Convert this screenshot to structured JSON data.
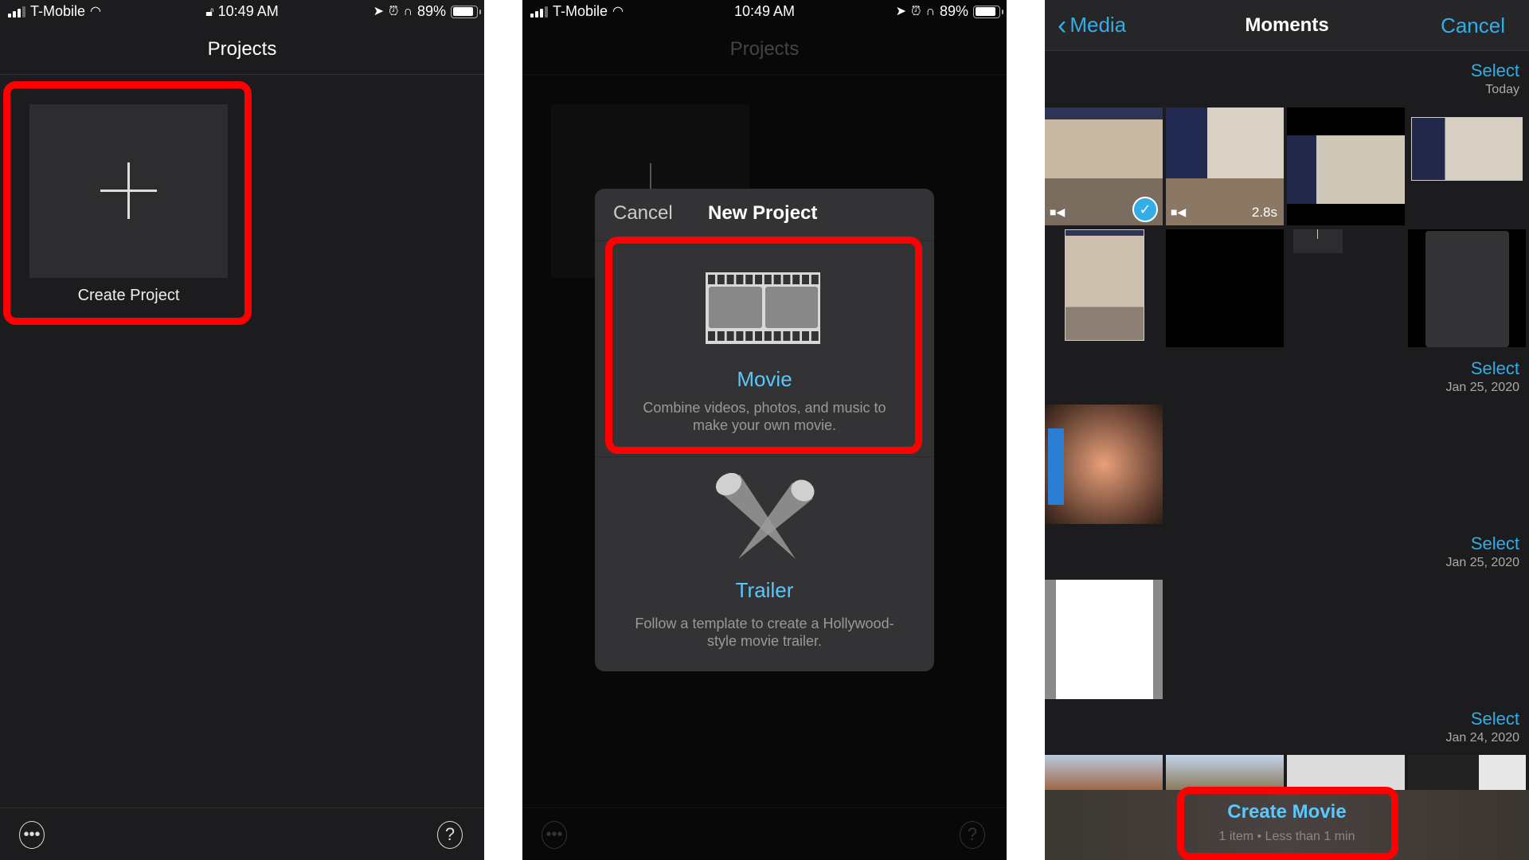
{
  "status_bar": {
    "carrier": "T-Mobile",
    "time": "10:49 AM",
    "battery": "89%",
    "battery_level": 0.89,
    "icons": [
      "signal-icon",
      "wifi-icon",
      "lock-icon",
      "location-icon",
      "alarm-icon",
      "headphones-icon",
      "battery-icon"
    ]
  },
  "panel1": {
    "title": "Projects",
    "create_project_label": "Create Project",
    "more_icon": "•••",
    "help_icon": "?"
  },
  "panel2": {
    "title": "Projects",
    "dialog": {
      "cancel_label": "Cancel",
      "title": "New Project",
      "options": [
        {
          "title": "Movie",
          "description": "Combine videos, photos, and music to make your own movie.",
          "icon": "film-strip-icon"
        },
        {
          "title": "Trailer",
          "description": "Follow a template to create a Hollywood-style movie trailer.",
          "icon": "spotlights-icon"
        }
      ]
    },
    "more_icon": "•••",
    "help_icon": "?"
  },
  "panel3": {
    "back_label": "Media",
    "title": "Moments",
    "cancel_label": "Cancel",
    "sections": [
      {
        "select_label": "Select",
        "date": "Today"
      },
      {
        "select_label": "Select",
        "date": "Jan 25, 2020"
      },
      {
        "select_label": "Select",
        "date": "Jan 25, 2020"
      },
      {
        "select_label": "Select",
        "date": "Jan 24, 2020"
      }
    ],
    "clip_duration": "2.8s",
    "create_movie_label": "Create Movie",
    "create_movie_sub": "1 item • Less than 1 min"
  },
  "colors": {
    "accent": "#5ac8fa",
    "link": "#32ade6",
    "highlight": "#ff0000",
    "background": "#1c1c1e"
  }
}
